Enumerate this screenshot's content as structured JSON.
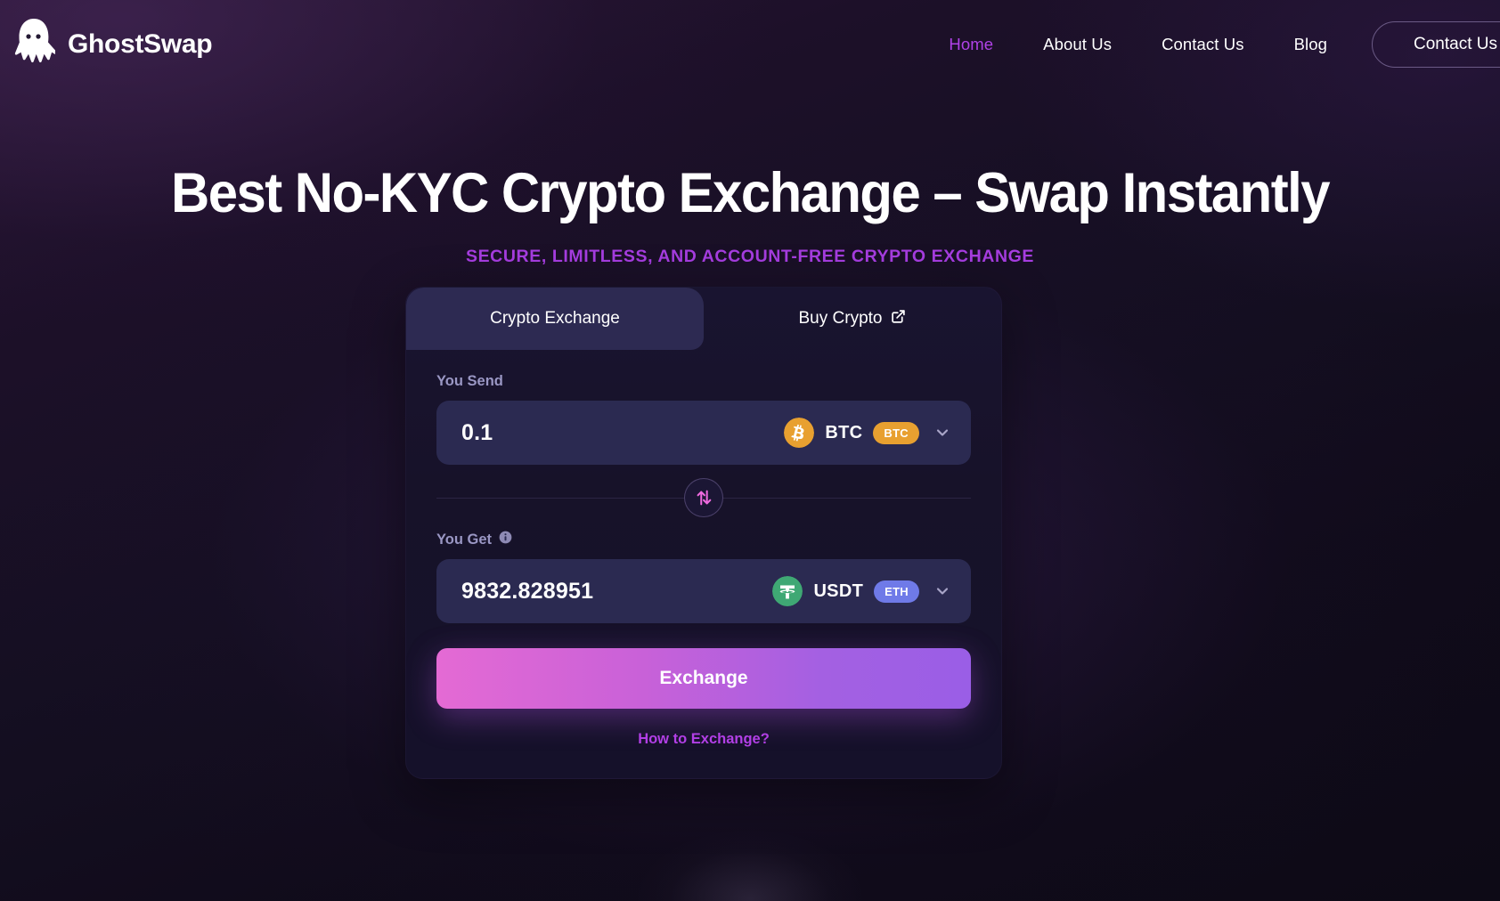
{
  "brand": {
    "name": "GhostSwap",
    "logo_icon": "ghost-icon"
  },
  "nav": {
    "items": [
      {
        "label": "Home",
        "active": true
      },
      {
        "label": "About Us",
        "active": false
      },
      {
        "label": "Contact Us",
        "active": false
      },
      {
        "label": "Blog",
        "active": false
      }
    ],
    "cta_label": "Contact Us"
  },
  "hero": {
    "title": "Best No-KYC Crypto Exchange – Swap Instantly",
    "subtitle": "Secure, Limitless, and Account-Free Crypto Exchange"
  },
  "swap_card": {
    "tabs": [
      {
        "label": "Crypto Exchange",
        "active": true,
        "icon": null
      },
      {
        "label": "Buy Crypto",
        "active": false,
        "icon": "external-link-icon"
      }
    ],
    "send": {
      "label": "You Send",
      "value": "0.1",
      "placeholder": "0",
      "coin_icon": "bitcoin-icon",
      "ticker": "BTC",
      "network_badge": "BTC",
      "chevron_icon": "chevron-down-icon"
    },
    "swap_toggle": {
      "icon": "swap-vertical-arrows-icon"
    },
    "get": {
      "label": "You Get",
      "info_icon": "info-icon",
      "value": "9832.828951",
      "placeholder": "0",
      "coin_icon": "tether-icon",
      "ticker": "USDT",
      "network_badge": "ETH",
      "chevron_icon": "chevron-down-icon"
    },
    "exchange_button": "Exchange",
    "how_link": "How to Exchange?"
  },
  "colors": {
    "accent_magenta": "#b042e8",
    "accent_pink": "#e46ad4",
    "btc_orange": "#e8a030",
    "eth_blue": "#6f7ae8",
    "usdt_green": "#26a17b",
    "card_bg": "#191430",
    "input_bg": "#2b2a51",
    "tab_active_bg": "#2d2a52"
  }
}
